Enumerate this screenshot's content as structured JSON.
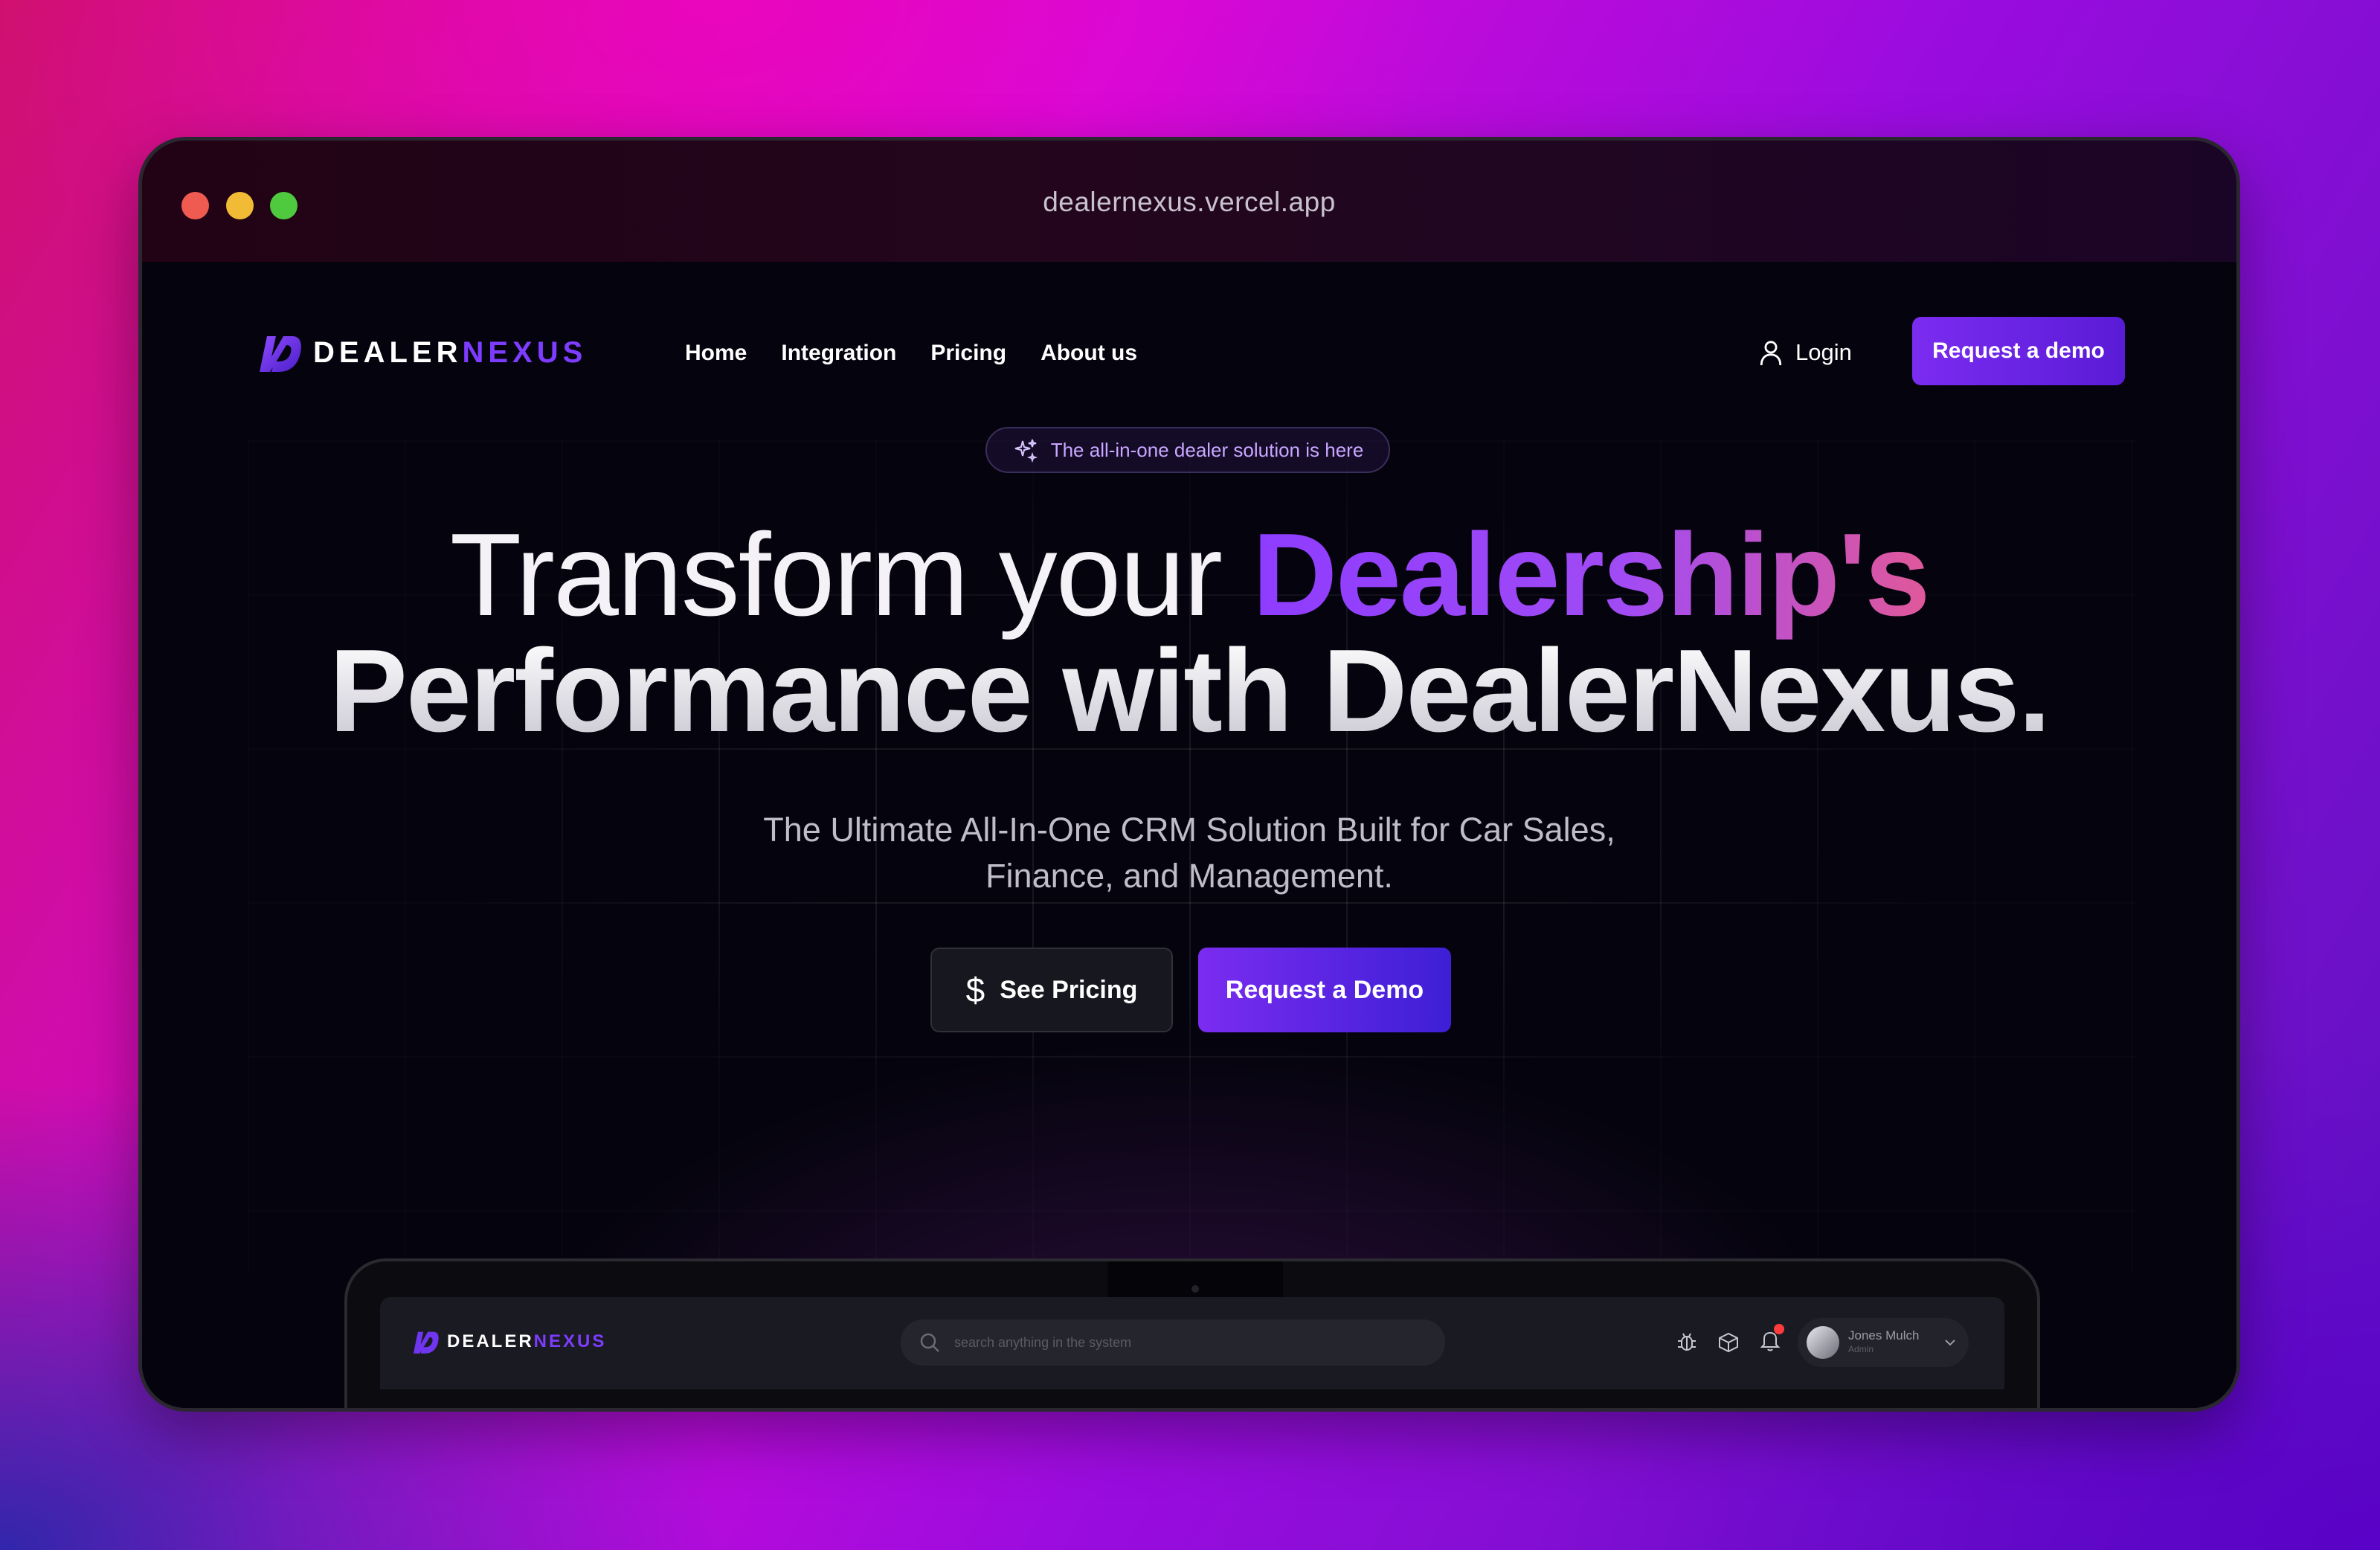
{
  "browser": {
    "url": "dealernexus.vercel.app"
  },
  "brand": {
    "name_part1": "DEALER",
    "name_part2": "NEXUS"
  },
  "nav": {
    "items": [
      {
        "label": "Home"
      },
      {
        "label": "Integration"
      },
      {
        "label": "Pricing"
      },
      {
        "label": "About us"
      }
    ],
    "login_label": "Login",
    "cta_label": "Request a demo"
  },
  "hero": {
    "badge": "The all-in-one dealer solution is here",
    "headline_line1_plain": "Transform your ",
    "headline_line1_accent": "Dealership's",
    "headline_line2": "Performance with DealerNexus.",
    "subtitle_line1": "The Ultimate All-In-One CRM Solution Built for Car Sales,",
    "subtitle_line2": "Finance, and Management.",
    "btn_secondary": "See Pricing",
    "btn_secondary_icon": "$",
    "btn_primary": "Request a Demo"
  },
  "preview": {
    "search_placeholder": "search anything in the system",
    "user_name": "Jones Mulch",
    "user_role": "Admin"
  },
  "colors": {
    "accent": "#7b2cf0",
    "accent_dark": "#3d1fd6",
    "background": "#05040e"
  }
}
